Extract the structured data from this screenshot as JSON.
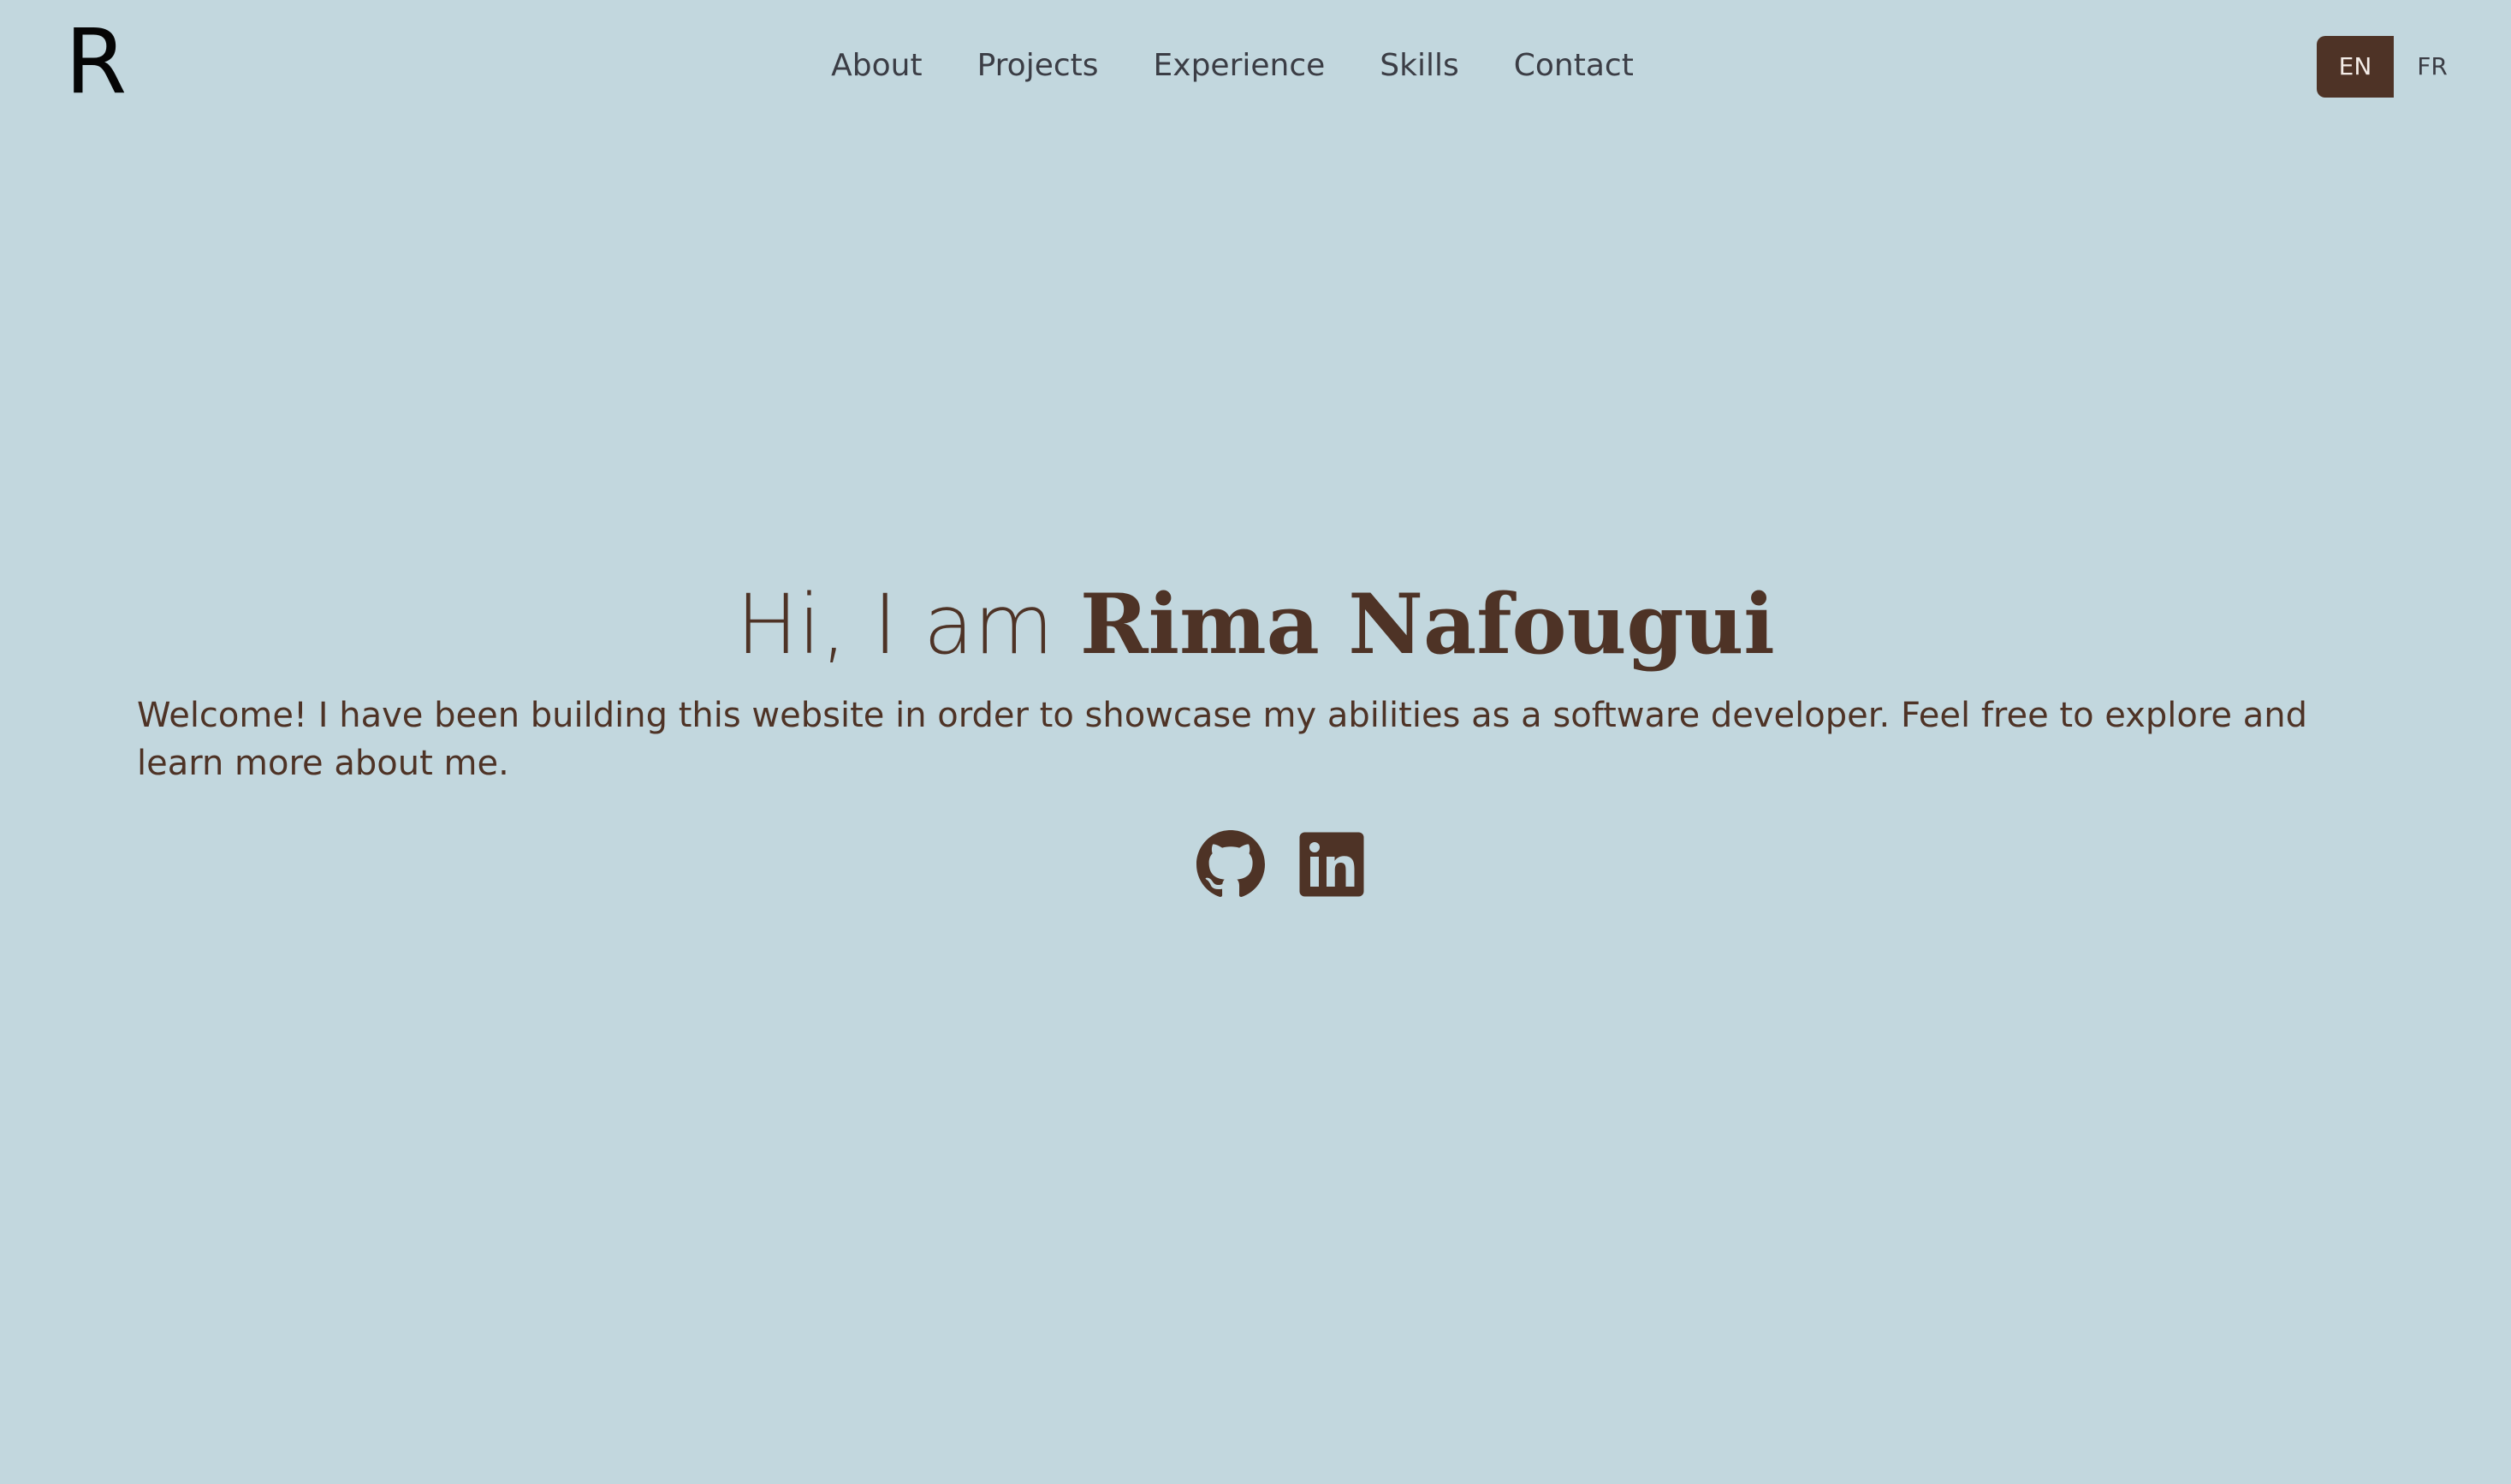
{
  "header": {
    "logo": "R",
    "nav": [
      {
        "label": "About"
      },
      {
        "label": "Projects"
      },
      {
        "label": "Experience"
      },
      {
        "label": "Skills"
      },
      {
        "label": "Contact"
      }
    ],
    "languages": {
      "active": "EN",
      "inactive": "FR"
    }
  },
  "hero": {
    "greeting": "Hi, I am ",
    "name": "Rima Nafougui",
    "intro": "Welcome! I have been building this website in order to showcase my abilities as a software developer. Feel free to explore and learn more about me."
  },
  "social": {
    "github_icon": "github-icon",
    "linkedin_icon": "linkedin-icon"
  },
  "colors": {
    "background": "#c2d7de",
    "accent": "#4e3326",
    "nav_text": "#3b3d45",
    "logo": "#050505"
  }
}
